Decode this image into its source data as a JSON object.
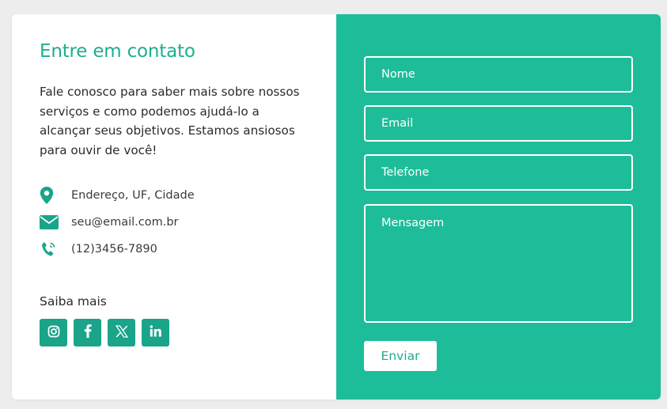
{
  "contact": {
    "title": "Entre em contato",
    "description": "Fale conosco para saber mais sobre nossos serviços e como podemos ajudá-lo a alcançar seus objetivos. Estamos ansiosos para ouvir de você!",
    "address": "Endereço, UF, Cidade",
    "email": "seu@email.com.br",
    "phone": "(12)3456-7890",
    "social_heading": "Saiba mais",
    "socials": [
      "instagram-icon",
      "facebook-icon",
      "x-icon",
      "linkedin-icon"
    ]
  },
  "form": {
    "name_placeholder": "Nome",
    "email_placeholder": "Email",
    "phone_placeholder": "Telefone",
    "message_placeholder": "Mensagem",
    "submit_label": "Enviar"
  },
  "colors": {
    "accent": "#1dbd9a",
    "accent_dark": "#1aa48a",
    "title": "#1dae8e",
    "background": "#ededed"
  }
}
